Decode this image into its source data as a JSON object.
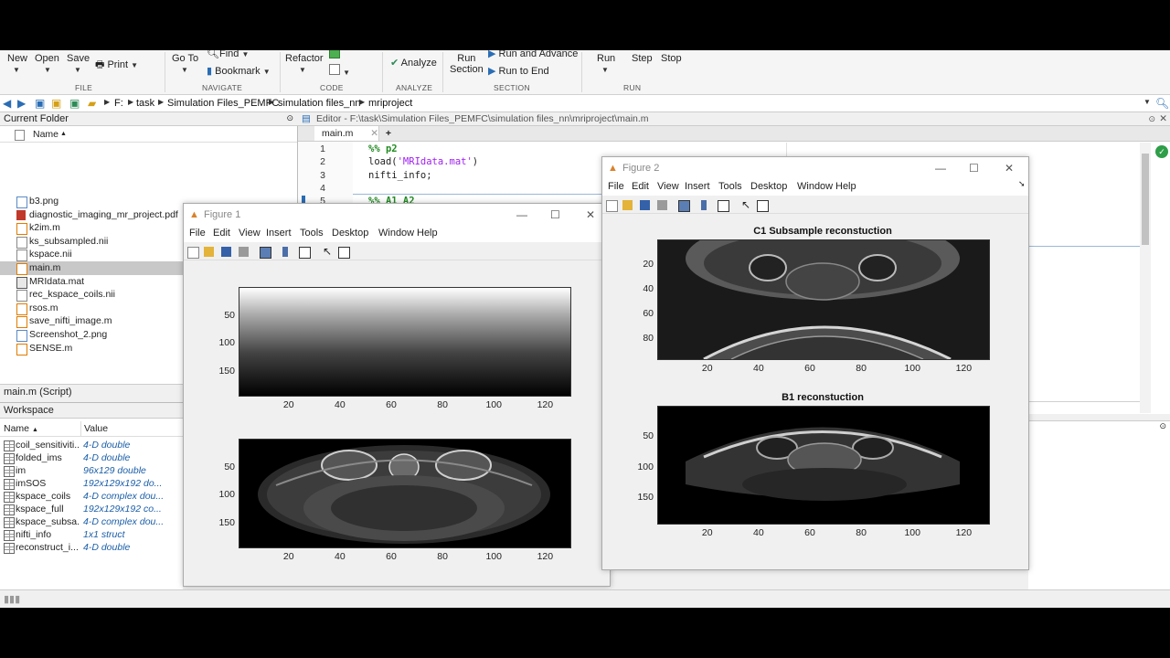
{
  "toolstrip": {
    "file": {
      "new": "New",
      "open": "Open",
      "save": "Save",
      "print": "Print",
      "section": "FILE"
    },
    "navigate": {
      "goto": "Go To",
      "find": "Find",
      "bookmark": "Bookmark",
      "section": "NAVIGATE"
    },
    "code": {
      "refactor": "Refactor",
      "section": "CODE"
    },
    "analyze": {
      "analyze": "Analyze",
      "section": "ANALYZE"
    },
    "section_group": {
      "run_section": "Run",
      "run_section2": "Section",
      "run_advance": "Run and Advance",
      "run_to_end": "Run to End",
      "section": "SECTION"
    },
    "run": {
      "run": "Run",
      "step": "Step",
      "stop": "Stop",
      "section": "RUN"
    }
  },
  "address": {
    "crumbs": [
      "F:",
      "task",
      "Simulation Files_PEMFC",
      "simulation files_nn",
      "mriproject"
    ]
  },
  "current_folder": {
    "title": "Current Folder",
    "col_name": "Name",
    "files": [
      {
        "name": "b3.png",
        "icon": "image-file-icon"
      },
      {
        "name": "diagnostic_imaging_mr_project.pdf",
        "icon": "pdf-file-icon"
      },
      {
        "name": "k2im.m",
        "icon": "mfile-icon"
      },
      {
        "name": "ks_subsampled.nii",
        "icon": "generic-file-icon"
      },
      {
        "name": "kspace.nii",
        "icon": "generic-file-icon"
      },
      {
        "name": "main.m",
        "icon": "mfile-icon"
      },
      {
        "name": "MRIdata.mat",
        "icon": "mat-file-icon"
      },
      {
        "name": "rec_kspace_coils.nii",
        "icon": "generic-file-icon"
      },
      {
        "name": "rsos.m",
        "icon": "mfile-icon"
      },
      {
        "name": "save_nifti_image.m",
        "icon": "mfile-icon"
      },
      {
        "name": "Screenshot_2.png",
        "icon": "image-file-icon"
      },
      {
        "name": "SENSE.m",
        "icon": "mfile-icon"
      }
    ],
    "selected": "main.m",
    "script_label": "main.m  (Script)"
  },
  "workspace": {
    "title": "Workspace",
    "col_name": "Name",
    "col_value": "Value",
    "vars": [
      {
        "name": "coil_sensitiviti...",
        "value": "4-D double"
      },
      {
        "name": "folded_ims",
        "value": "4-D double"
      },
      {
        "name": "im",
        "value": "96x129 double"
      },
      {
        "name": "imSOS",
        "value": "192x129x192 do..."
      },
      {
        "name": "kspace_coils",
        "value": "4-D complex dou..."
      },
      {
        "name": "kspace_full",
        "value": "192x129x192 co..."
      },
      {
        "name": "kspace_subsa...",
        "value": "4-D complex dou..."
      },
      {
        "name": "nifti_info",
        "value": "1x1 struct"
      },
      {
        "name": "reconstruct_i...",
        "value": "4-D double"
      }
    ]
  },
  "editor": {
    "title": "Editor - F:\\task\\Simulation Files_PEMFC\\simulation files_nn\\mriproject\\main.m",
    "tab": "main.m",
    "add_tab": "+",
    "lines": [
      {
        "n": "1",
        "text": "%% p2",
        "kind": "comment"
      },
      {
        "n": "2",
        "pre": "load(",
        "str": "'MRIdata.mat'",
        "post": ")",
        "kind": "call"
      },
      {
        "n": "3",
        "text": "nifti_info;",
        "kind": "plain"
      },
      {
        "n": "4",
        "text": "",
        "kind": "plain"
      },
      {
        "n": "5",
        "text": "%% A1 A2",
        "kind": "comment"
      }
    ]
  },
  "figure1": {
    "title": "Figure 1",
    "menu": [
      "File",
      "Edit",
      "View",
      "Insert",
      "Tools",
      "Desktop",
      "Window",
      "Help"
    ],
    "axes1": {
      "yticks": [
        "50",
        "100",
        "150"
      ],
      "xticks": [
        "20",
        "40",
        "60",
        "80",
        "100",
        "120"
      ]
    },
    "axes2": {
      "yticks": [
        "50",
        "100",
        "150"
      ],
      "xticks": [
        "20",
        "40",
        "60",
        "80",
        "100",
        "120"
      ]
    }
  },
  "figure2": {
    "title": "Figure 2",
    "menu": [
      "File",
      "Edit",
      "View",
      "Insert",
      "Tools",
      "Desktop",
      "Window",
      "Help"
    ],
    "axes1": {
      "title": "C1 Subsample reconstuction",
      "yticks": [
        "20",
        "40",
        "60",
        "80"
      ],
      "xticks": [
        "20",
        "40",
        "60",
        "80",
        "100",
        "120"
      ]
    },
    "axes2": {
      "title": "B1 reconstuction",
      "yticks": [
        "50",
        "100",
        "150"
      ],
      "xticks": [
        "20",
        "40",
        "60",
        "80",
        "100",
        "120"
      ]
    }
  },
  "colors": {
    "accent": "#2a6db5",
    "comment": "#228b22",
    "string": "#a020f0",
    "selection": "#c8c8c8"
  }
}
